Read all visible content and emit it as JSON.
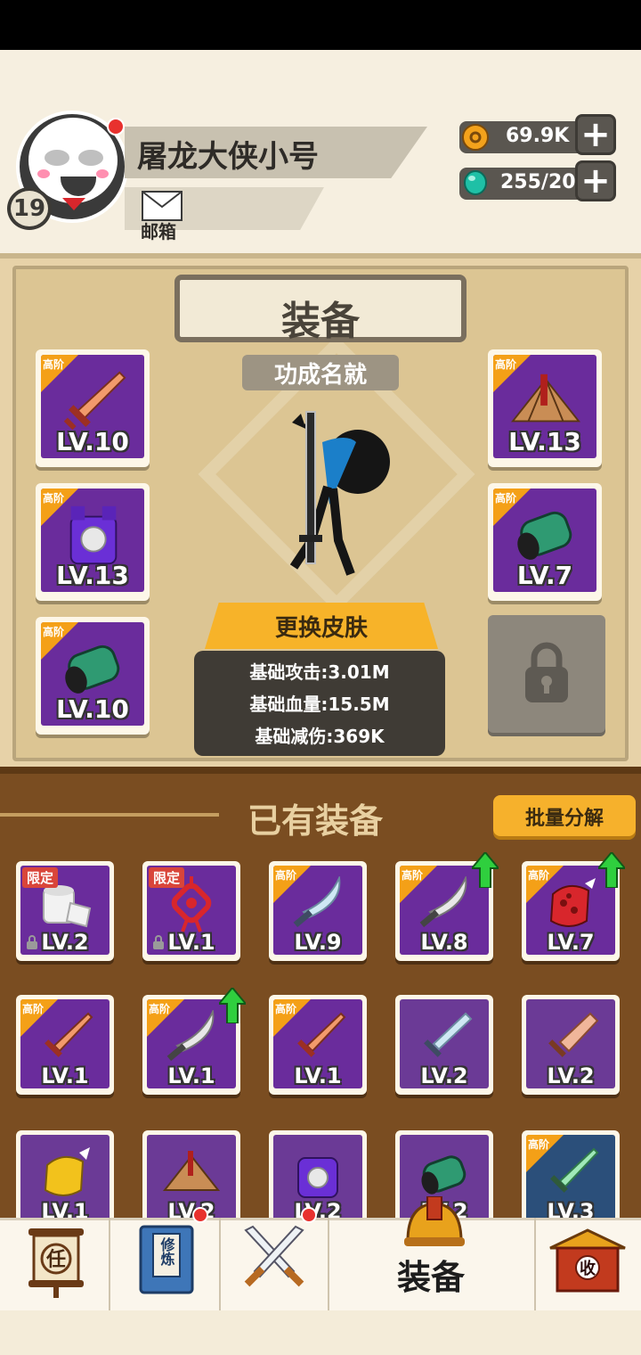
{
  "player": {
    "name": "屠龙大侠小号",
    "level": "19",
    "mail_label": "邮箱"
  },
  "resources": {
    "coins": "69.9K",
    "gems": "255/20",
    "plus": "+"
  },
  "equipment_panel": {
    "title": "装备",
    "subtitle": "功成名就",
    "change_skin": "更换皮肤",
    "stats": {
      "attack": "基础攻击:3.01M",
      "hp": "基础血量:15.5M",
      "damage_reduction": "基础减伤:369K"
    },
    "slots": [
      {
        "grade": "高阶",
        "level": "LV.10",
        "item": "sword"
      },
      {
        "grade": "高阶",
        "level": "LV.13",
        "item": "hat"
      },
      {
        "grade": "高阶",
        "level": "LV.13",
        "item": "armor"
      },
      {
        "grade": "高阶",
        "level": "LV.7",
        "item": "bracer"
      },
      {
        "grade": "高阶",
        "level": "LV.10",
        "item": "bracer"
      }
    ]
  },
  "owned": {
    "title": "已有装备",
    "batch_button": "批量分解",
    "items": [
      {
        "tag": "限定",
        "level": "LV.2",
        "item": "scroll"
      },
      {
        "tag": "限定",
        "level": "LV.1",
        "item": "knot"
      },
      {
        "grade": "高阶",
        "level": "LV.9",
        "item": "saber"
      },
      {
        "grade": "高阶",
        "level": "LV.8",
        "item": "saber"
      },
      {
        "grade": "高阶",
        "level": "LV.7",
        "item": "gauntlet"
      },
      {
        "grade": "高阶",
        "level": "LV.1",
        "item": "sword"
      },
      {
        "grade": "高阶",
        "level": "LV.1",
        "item": "saber"
      },
      {
        "grade": "高阶",
        "level": "LV.1",
        "item": "sword"
      },
      {
        "level": "LV.2",
        "item": "blade"
      },
      {
        "level": "LV.2",
        "item": "cleaver"
      },
      {
        "level": "LV.1",
        "item": "gauntlet"
      },
      {
        "level": "LV.2",
        "item": "hat"
      },
      {
        "level": "LV.2",
        "item": "armor"
      },
      {
        "level": "LV.2",
        "item": "bracer"
      },
      {
        "grade": "高阶",
        "level": "LV.3",
        "item": "jade-sword"
      }
    ]
  },
  "nav": {
    "task_char": "任",
    "cultivate": "修炼",
    "equip_label": "装备",
    "collect_char": "收"
  },
  "colors": {
    "purple": "#6a2c9c",
    "grade_orange": "#f4a017",
    "panel_brown": "#7a4d21",
    "upgrade_green": "#2fcf3e"
  }
}
